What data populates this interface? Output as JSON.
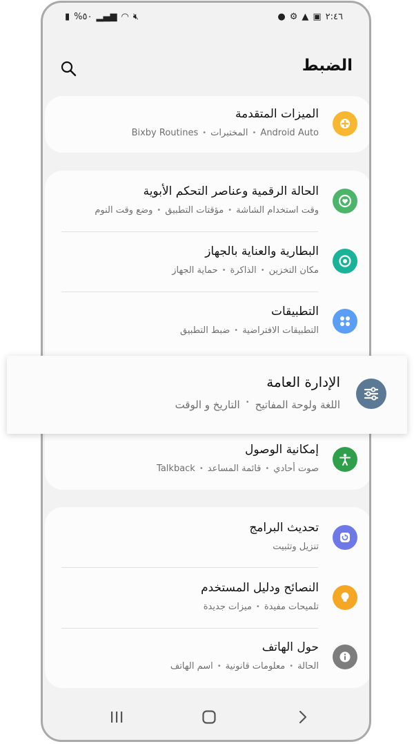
{
  "status_bar": {
    "time": "٢:٤٦",
    "battery": "%٥٠"
  },
  "header": {
    "title": "الضبط"
  },
  "sections": {
    "advanced": {
      "title": "الميزات المتقدمة",
      "sub": [
        "Android Auto",
        "المختبرات",
        "Bixby Routines"
      ]
    },
    "digital": {
      "title": "الحالة الرقمية وعناصر التحكم الأبوية",
      "sub": [
        "وقت استخدام الشاشة",
        "مؤقتات التطبيق",
        "وضع وقت النوم"
      ]
    },
    "battery": {
      "title": "البطارية والعناية بالجهاز",
      "sub": [
        "مكان التخزين",
        "الذاكرة",
        "حماية الجهاز"
      ]
    },
    "apps": {
      "title": "التطبيقات",
      "sub": [
        "التطبيقات الافتراضية",
        "ضبط التطبيق"
      ]
    },
    "general": {
      "title": "الإدارة العامة",
      "sub": [
        "اللغة ولوحة المفاتيح",
        "التاريخ و الوقت"
      ]
    },
    "accessibility": {
      "title": "إمكانية الوصول",
      "sub": [
        "صوت أحادي",
        "قائمة المساعد",
        "Talkback"
      ]
    },
    "update": {
      "title": "تحديث البرامج",
      "sub": [
        "تنزيل وتثبيت"
      ]
    },
    "tips": {
      "title": "النصائح ودليل المستخدم",
      "sub": [
        "تلميحات مفيدة",
        "ميزات جديدة"
      ]
    },
    "about": {
      "title": "حول الهاتف",
      "sub": [
        "الحالة",
        "معلومات قانونية",
        "اسم الهاتف"
      ]
    }
  },
  "colors": {
    "advanced": "#f7b731",
    "digital": "#4cb56a",
    "battery": "#1ab39a",
    "apps": "#5b9ef6",
    "general": "#5b7895",
    "accessibility": "#2f9f4b",
    "update": "#6e78e6",
    "tips": "#f5a623",
    "about": "#7d7d7d"
  },
  "icons": {
    "search": "search-icon",
    "advanced": "puzzle-plus-icon",
    "digital": "heart-ring-icon",
    "battery": "refresh-ring-icon",
    "apps": "four-dots-icon",
    "general": "sliders-icon",
    "accessibility": "person-icon",
    "update": "update-icon",
    "tips": "lightbulb-icon",
    "about": "info-icon",
    "nav_recent": "recent-apps-icon",
    "nav_home": "home-icon",
    "nav_back": "back-icon"
  }
}
